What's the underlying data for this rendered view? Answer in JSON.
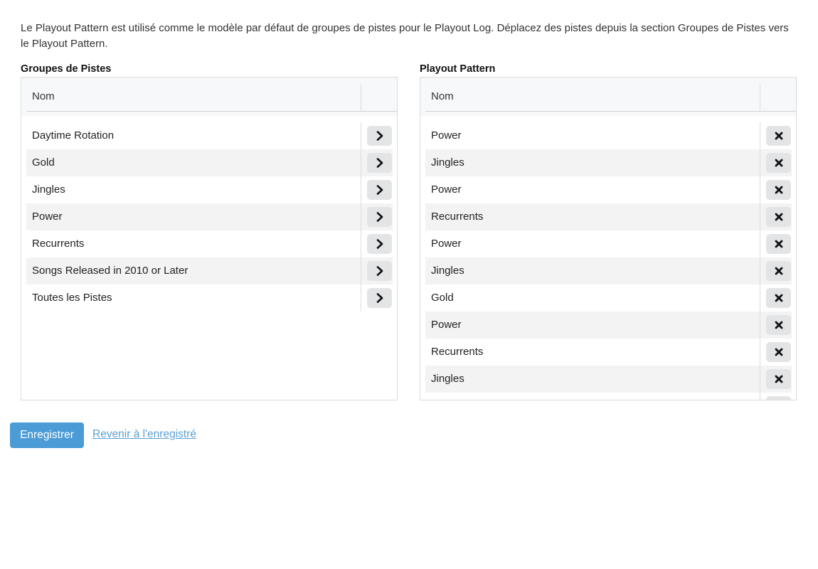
{
  "intro_text": "Le Playout Pattern est utilisé comme le modèle par défaut de groupes de pistes pour le Playout Log. Déplacez des pistes depuis la section Groupes de Pistes vers le Playout Pattern.",
  "left_panel": {
    "title": "Groupes de Pistes",
    "column_name": "Nom",
    "button_icon": "chevron-right-icon",
    "items": [
      "Daytime Rotation",
      "Gold",
      "Jingles",
      "Power",
      "Recurrents",
      "Songs Released in 2010 or Later",
      "Toutes les Pistes"
    ]
  },
  "right_panel": {
    "title": "Playout Pattern",
    "column_name": "Nom",
    "button_icon": "remove-x-icon",
    "items": [
      "Power",
      "Jingles",
      "Power",
      "Recurrents",
      "Power",
      "Jingles",
      "Gold",
      "Power",
      "Recurrents",
      "Jingles",
      ""
    ]
  },
  "actions": {
    "save_label": "Enregistrer",
    "revert_label": "Revenir à l'enregistré"
  },
  "colors": {
    "primary_button": "#4a9bd6",
    "link": "#5a9fd4",
    "row_alt": "#f3f3f3",
    "header_bg": "#f7f8f9"
  }
}
